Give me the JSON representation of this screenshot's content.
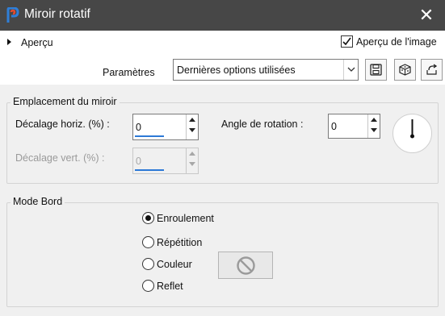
{
  "window": {
    "title": "Miroir rotatif",
    "close_glyph": "✕"
  },
  "preview": {
    "label": "Aperçu",
    "image_checkbox_label": "Aperçu de l'image",
    "image_checked": true
  },
  "presets": {
    "label": "Paramètres",
    "selected": "Dernières options utilisées"
  },
  "mirror_group": {
    "title": "Emplacement du miroir",
    "horiz_label": "Décalage horiz. (%) :",
    "horiz_value": "0",
    "vert_label": "Décalage vert. (%) :",
    "vert_value": "0",
    "rotation_label": "Angle de rotation :",
    "rotation_value": "0"
  },
  "edge_group": {
    "title": "Mode Bord",
    "options": [
      "Enroulement",
      "Répétition",
      "Couleur",
      "Reflet"
    ],
    "selected": "Enroulement"
  },
  "icons": [
    "app-icon",
    "close-icon",
    "dropdown-arrow-icon",
    "save-preset-icon",
    "randomize-icon",
    "reset-icon",
    "no-color-icon",
    "rotation-dial-icon"
  ]
}
